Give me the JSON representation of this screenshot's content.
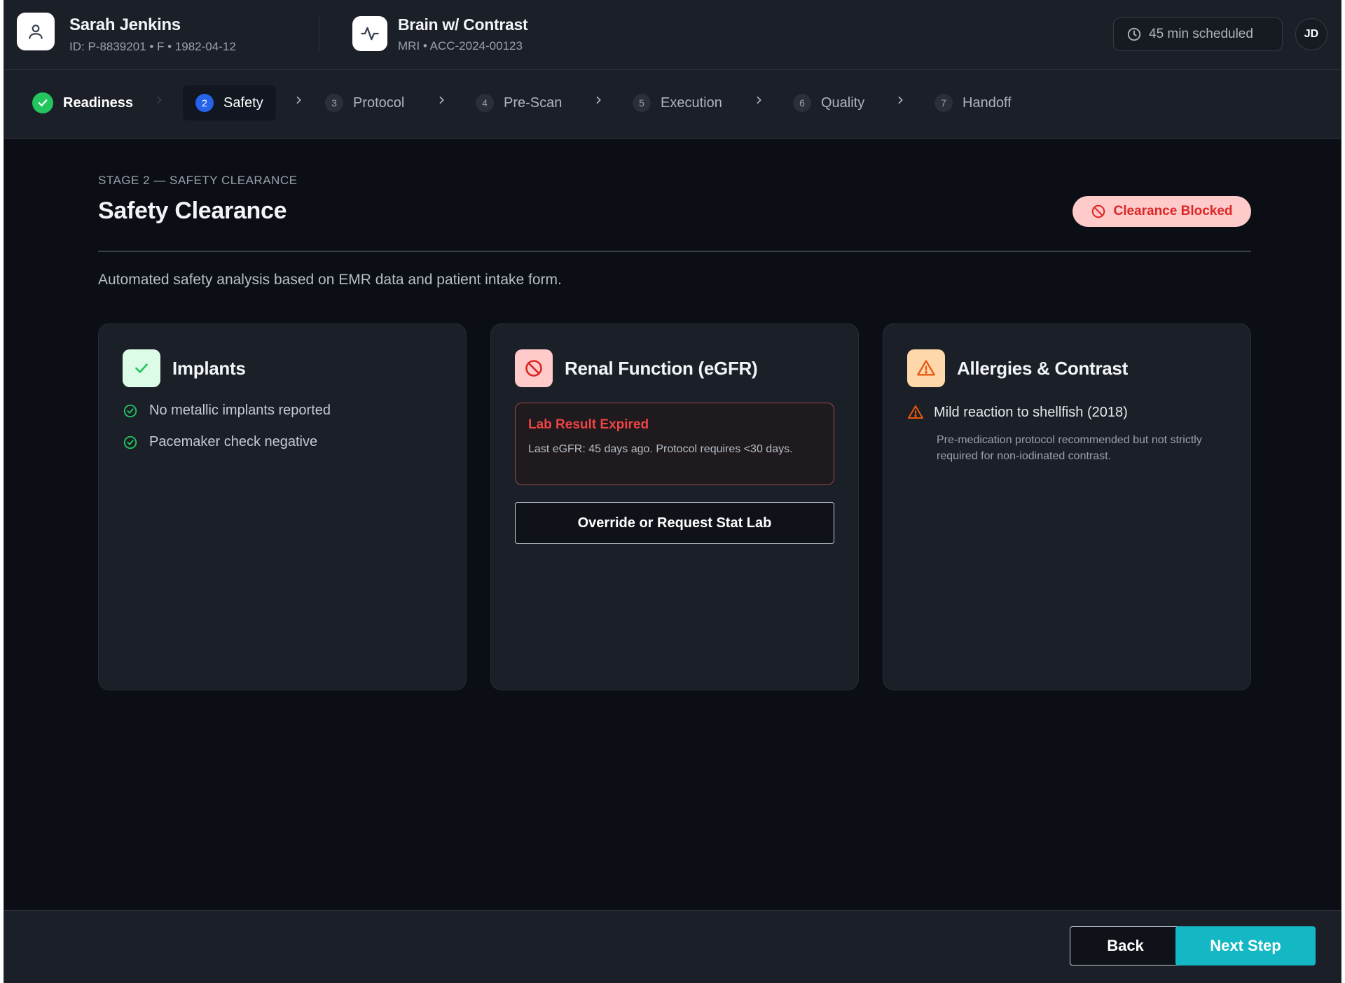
{
  "patient": {
    "name": "Sarah Jenkins",
    "meta": "ID: P-8839201 • F • 1982-04-12",
    "icon": "user-icon"
  },
  "exam": {
    "title": "Brain w/ Contrast",
    "meta": "MRI • ACC-2024-00123",
    "icon": "activity-icon"
  },
  "schedule": {
    "label": "45 min scheduled",
    "icon": "clock-icon"
  },
  "user": {
    "initials": "JD"
  },
  "steps": [
    {
      "num": "1",
      "label": "Readiness",
      "status": "done"
    },
    {
      "num": "2",
      "label": "Safety",
      "status": "active"
    },
    {
      "num": "3",
      "label": "Protocol",
      "status": "pending"
    },
    {
      "num": "4",
      "label": "Pre-Scan",
      "status": "pending"
    },
    {
      "num": "5",
      "label": "Execution",
      "status": "pending"
    },
    {
      "num": "6",
      "label": "Quality",
      "status": "pending"
    },
    {
      "num": "7",
      "label": "Handoff",
      "status": "pending"
    }
  ],
  "page": {
    "eyebrow": "STAGE 2 — SAFETY CLEARANCE",
    "title": "Safety Clearance",
    "status_badge": "Clearance Blocked",
    "description": "Automated safety analysis based on EMR data and patient intake form."
  },
  "cards": {
    "implants": {
      "title": "Implants",
      "items": [
        "No metallic implants reported",
        "Pacemaker check negative"
      ]
    },
    "renal": {
      "title": "Renal Function (eGFR)",
      "alert_title": "Lab Result Expired",
      "alert_body": "Last eGFR: 45 days ago. Protocol requires <30 days.",
      "action_label": "Override or Request Stat Lab"
    },
    "allergies": {
      "title": "Allergies & Contrast",
      "item": "Mild reaction to shellfish (2018)",
      "note": "Pre-medication protocol recommended but not strictly required for non-iodinated contrast."
    }
  },
  "footer": {
    "back_label": "Back",
    "next_label": "Next Step"
  },
  "colors": {
    "background": "#0b0e14",
    "panel": "#1b1f27",
    "accent": "#14b8c4",
    "active_step": "#2563eb",
    "success": "#22c55e",
    "danger": "#ef4444",
    "warning": "#f97316"
  }
}
